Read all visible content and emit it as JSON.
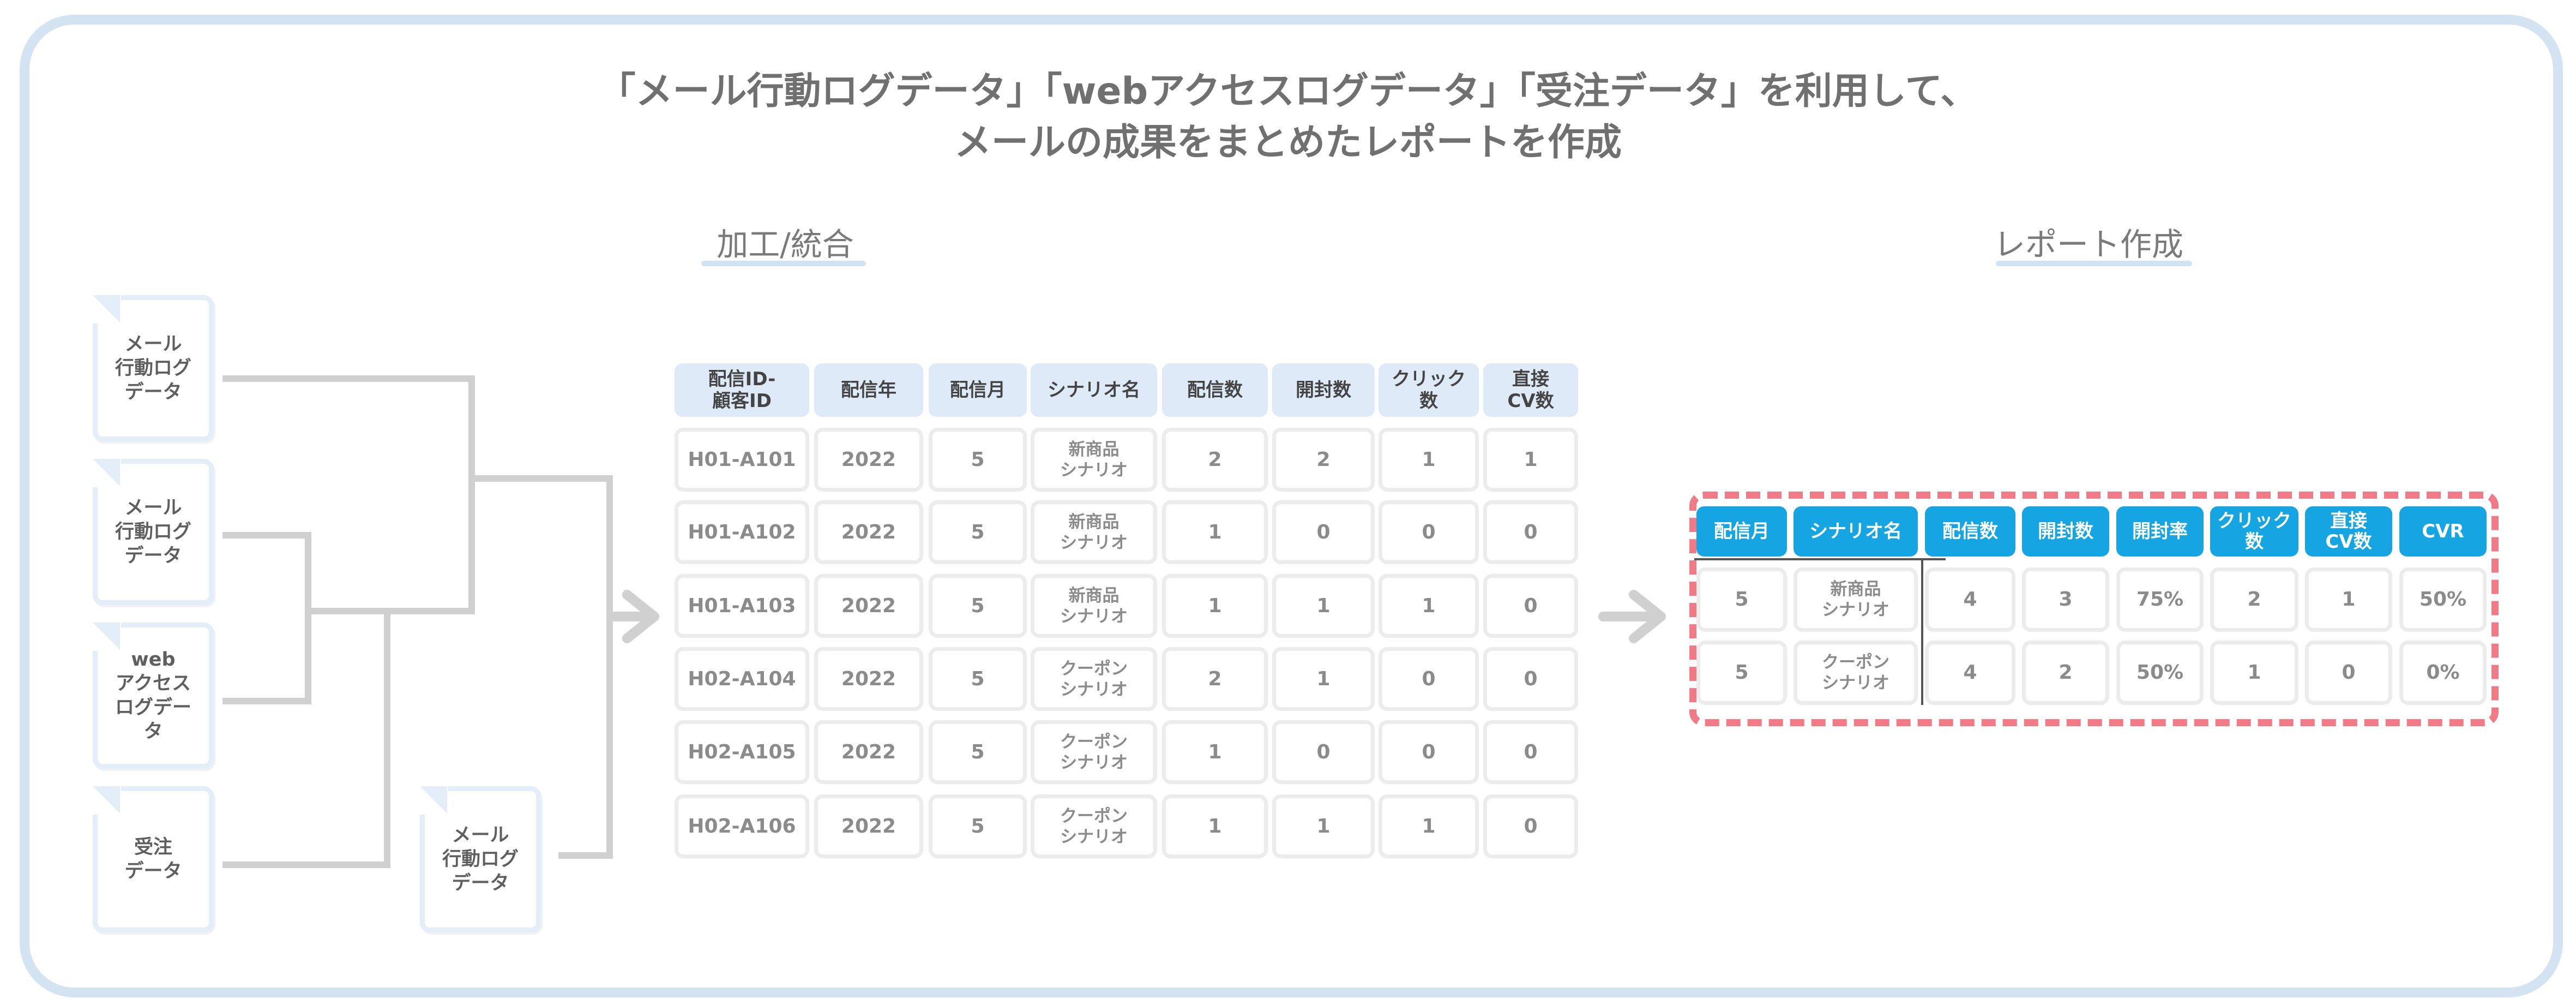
{
  "title": {
    "line1": "「メール行動ログデータ」「webアクセスログデータ」「受注データ」を利用して、",
    "line2": "メールの成果をまとめたレポートを作成"
  },
  "sections": {
    "process_label": "加工/統合",
    "report_label": "レポート作成"
  },
  "sources": [
    {
      "label": "メール\n行動ログ\nデータ"
    },
    {
      "label": "メール\n行動ログ\nデータ"
    },
    {
      "label": "web\nアクセス\nログデー\nタ"
    },
    {
      "label": "受注\nデータ"
    },
    {
      "label": "メール\n行動ログ\nデータ"
    }
  ],
  "merged_table": {
    "headers": [
      "配信ID-\n顧客ID",
      "配信年",
      "配信月",
      "シナリオ名",
      "配信数",
      "開封数",
      "クリック\n数",
      "直接\nCV数"
    ],
    "rows": [
      [
        "H01-A101",
        "2022",
        "5",
        "新商品\nシナリオ",
        "2",
        "2",
        "1",
        "1"
      ],
      [
        "H01-A102",
        "2022",
        "5",
        "新商品\nシナリオ",
        "1",
        "0",
        "0",
        "0"
      ],
      [
        "H01-A103",
        "2022",
        "5",
        "新商品\nシナリオ",
        "1",
        "1",
        "1",
        "0"
      ],
      [
        "H02-A104",
        "2022",
        "5",
        "クーポン\nシナリオ",
        "2",
        "1",
        "0",
        "0"
      ],
      [
        "H02-A105",
        "2022",
        "5",
        "クーポン\nシナリオ",
        "1",
        "0",
        "0",
        "0"
      ],
      [
        "H02-A106",
        "2022",
        "5",
        "クーポン\nシナリオ",
        "1",
        "1",
        "1",
        "0"
      ]
    ]
  },
  "report_table": {
    "headers": [
      "配信月",
      "シナリオ名",
      "配信数",
      "開封数",
      "開封率",
      "クリック\n数",
      "直接\nCV数",
      "CVR"
    ],
    "rows": [
      [
        "5",
        "新商品\nシナリオ",
        "4",
        "3",
        "75%",
        "2",
        "1",
        "50%"
      ],
      [
        "5",
        "クーポン\nシナリオ",
        "4",
        "2",
        "50%",
        "1",
        "0",
        "0%"
      ]
    ]
  },
  "colors": {
    "frame": "#d4e3f2",
    "header_light": "#deeaf7",
    "header_blue": "#15a5e3",
    "report_border": "#f07a86",
    "connector": "#d0d0d0"
  }
}
